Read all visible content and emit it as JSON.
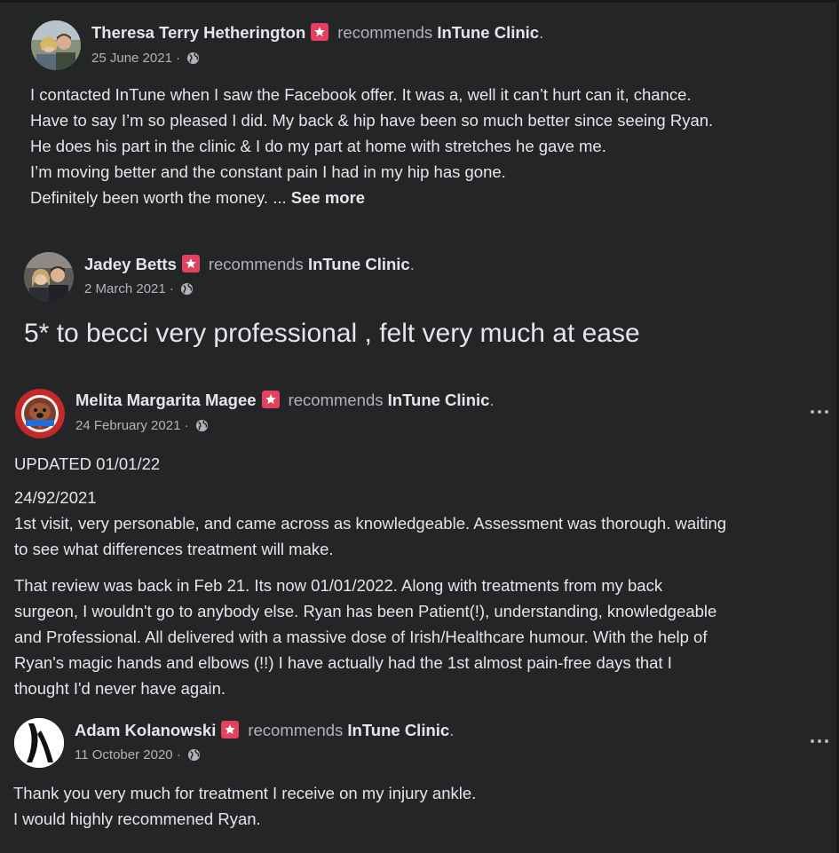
{
  "reviews": [
    {
      "author": "Theresa Terry Hetherington",
      "action": "recommends",
      "page": "InTune Clinic",
      "period": ".",
      "date": "25 June 2021",
      "separator": "·",
      "audience_icon": "globe-icon",
      "lines": [
        "I contacted InTune when I saw the Facebook offer. It was a, well it can’t hurt can it, chance.",
        "Have to say I’m so pleased I did. My back & hip have been so much better since seeing Ryan.",
        "He does his part in the clinic & I do my part at home with stretches he gave me.",
        "I’m moving better and the constant pain I had in my hip has gone."
      ],
      "last_line": "Definitely been worth the money. ...",
      "see_more": "See more"
    },
    {
      "author": "Jadey Betts",
      "action": "recommends",
      "page": "InTune Clinic",
      "period": ".",
      "date": "2 March 2021",
      "separator": "·",
      "audience_icon": "globe-icon",
      "text": "5* to becci very professional , felt very much at ease"
    },
    {
      "author": "Melita Margarita Magee",
      "action": "recommends",
      "page": "InTune Clinic",
      "period": ".",
      "date": "24 February 2021",
      "separator": "·",
      "audience_icon": "globe-icon",
      "more_icon": "more-horizontal-icon",
      "paragraph1": "UPDATED 01/01/22",
      "paragraph2_lines": [
        "24/92/2021",
        "1st visit, very personable, and came across as knowledgeable. Assessment was thorough. waiting",
        "to see what differences treatment will make."
      ],
      "paragraph3_lines": [
        "That review was back in Feb 21. Its now 01/01/2022. Along with treatments from my back",
        "surgeon, I wouldn't go to anybody else. Ryan has been Patient(!), understanding, knowledgeable",
        "and Professional. All delivered with a massive dose of Irish/Healthcare humour. With the help of",
        "Ryan's magic hands and elbows (!!) I have actually had the 1st almost pain-free days that I",
        "thought I'd never have again."
      ]
    },
    {
      "author": "Adam Kolanowski",
      "action": "recommends",
      "page": "InTune Clinic",
      "period": ".",
      "date": "11 October 2020",
      "separator": "·",
      "audience_icon": "globe-icon",
      "more_icon": "more-horizontal-icon",
      "lines": [
        "Thank you very much for treatment I receive on my injury ankle.",
        "I would highly recommened Ryan."
      ]
    }
  ],
  "colors": {
    "background": "#242526",
    "primary_text": "#e4e6eb",
    "secondary_text": "#b0b3b8",
    "recommend_badge": "#e4405f"
  }
}
